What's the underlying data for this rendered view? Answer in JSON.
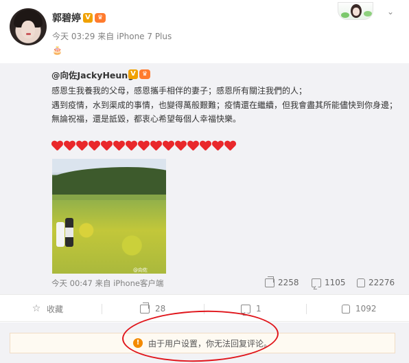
{
  "post": {
    "author": "郭碧婷",
    "verified_badge": "V",
    "member_badge": "♛",
    "time": "今天 03:29",
    "source": "来自 iPhone 7 Plus",
    "emoji": "🎂"
  },
  "repost": {
    "author": "@向佐JackyHeung",
    "verified_badge": "V",
    "member_badge": "♛",
    "lines": [
      "感恩生我養我的父母，感恩攜手相伴的妻子；感恩所有關注我們的人；",
      "遇到疫情，水到渠成的事情，也變得萬般艱難；疫情還在繼續，但我會盡其所能儘快到你身邊；",
      "無論祝福，還是詆毀，都衷心希望每個人幸福快樂。"
    ],
    "heart_count": 15,
    "image_watermark": "@向佐",
    "time": "今天 00:47",
    "source": "来自 iPhone客户端",
    "shares": "2258",
    "comments": "1105",
    "likes": "22276"
  },
  "actions": {
    "favorite_label": "收藏",
    "share_count": "28",
    "comment_count": "1",
    "like_count": "1092"
  },
  "notice": {
    "text": "由于用户设置，你无法回复评论。",
    "icon": "!"
  },
  "colors": {
    "accent_red": "#e0151b",
    "badge_orange": "#f0a100",
    "warn_orange": "#f38a00"
  }
}
